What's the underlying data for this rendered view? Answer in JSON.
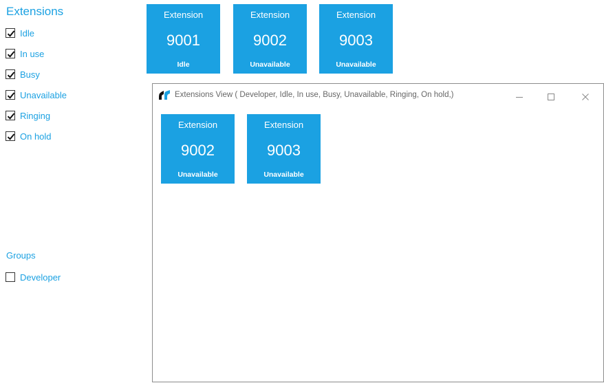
{
  "extensions_section": {
    "title": "Extensions",
    "filters": [
      {
        "label": "Idle",
        "checked": true
      },
      {
        "label": "In use",
        "checked": true
      },
      {
        "label": "Busy",
        "checked": true
      },
      {
        "label": "Unavailable",
        "checked": true
      },
      {
        "label": "Ringing",
        "checked": true
      },
      {
        "label": "On hold",
        "checked": true
      }
    ]
  },
  "groups_section": {
    "title": "Groups",
    "filters": [
      {
        "label": "Developer",
        "checked": false
      }
    ]
  },
  "tiles": [
    {
      "label": "Extension",
      "number": "9001",
      "status": "Idle"
    },
    {
      "label": "Extension",
      "number": "9002",
      "status": "Unavailable"
    },
    {
      "label": "Extension",
      "number": "9003",
      "status": "Unavailable"
    }
  ],
  "window": {
    "title": "Extensions View ( Developer, Idle, In use, Busy, Unavailable, Ringing, On hold,)",
    "controls": {
      "minimize": "minimize-icon",
      "maximize": "maximize-icon",
      "close": "close-icon"
    },
    "tiles": [
      {
        "label": "Extension",
        "number": "9002",
        "status": "Unavailable"
      },
      {
        "label": "Extension",
        "number": "9003",
        "status": "Unavailable"
      }
    ]
  },
  "colors": {
    "accent": "#1ba1e2",
    "tile_text": "#ffffff"
  }
}
